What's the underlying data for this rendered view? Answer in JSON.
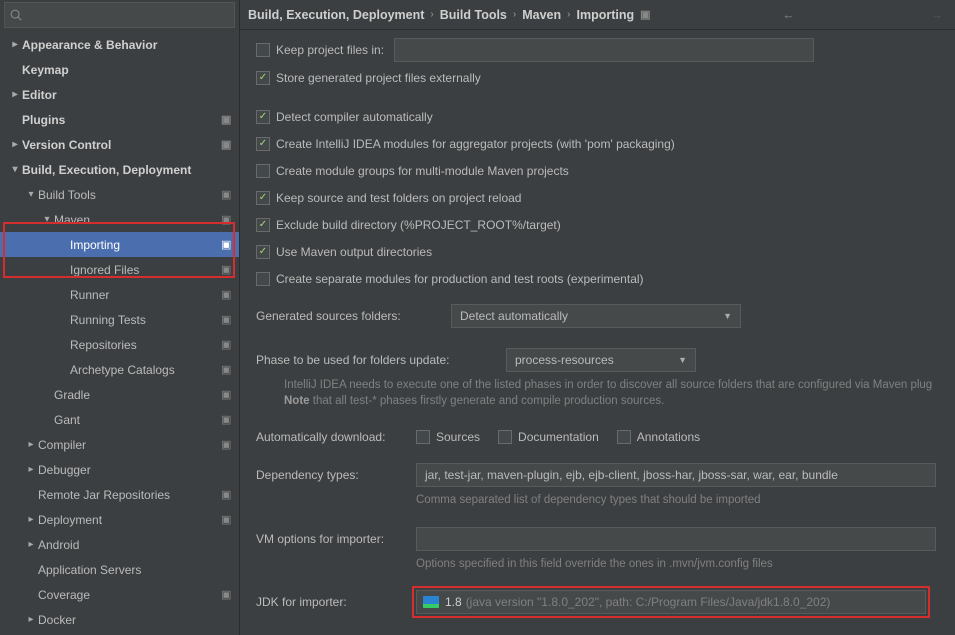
{
  "breadcrumb": [
    "Build, Execution, Deployment",
    "Build Tools",
    "Maven",
    "Importing"
  ],
  "sidebar": {
    "items": [
      {
        "label": "Appearance & Behavior",
        "indent": 0,
        "kind": "group",
        "arrow": "right",
        "bold": true,
        "gear": false
      },
      {
        "label": "Keymap",
        "indent": 0,
        "kind": "item",
        "arrow": "none",
        "bold": true,
        "gear": false
      },
      {
        "label": "Editor",
        "indent": 0,
        "kind": "group",
        "arrow": "right",
        "bold": true,
        "gear": false
      },
      {
        "label": "Plugins",
        "indent": 0,
        "kind": "item",
        "arrow": "none",
        "bold": true,
        "gear": true
      },
      {
        "label": "Version Control",
        "indent": 0,
        "kind": "group",
        "arrow": "right",
        "bold": true,
        "gear": true
      },
      {
        "label": "Build, Execution, Deployment",
        "indent": 0,
        "kind": "group",
        "arrow": "down",
        "bold": true,
        "gear": false
      },
      {
        "label": "Build Tools",
        "indent": 1,
        "kind": "group",
        "arrow": "down",
        "bold": false,
        "gear": true
      },
      {
        "label": "Maven",
        "indent": 2,
        "kind": "group",
        "arrow": "down",
        "bold": false,
        "gear": true
      },
      {
        "label": "Importing",
        "indent": 3,
        "kind": "item",
        "arrow": "none",
        "bold": false,
        "gear": true,
        "selected": true
      },
      {
        "label": "Ignored Files",
        "indent": 3,
        "kind": "item",
        "arrow": "none",
        "bold": false,
        "gear": true
      },
      {
        "label": "Runner",
        "indent": 3,
        "kind": "item",
        "arrow": "none",
        "bold": false,
        "gear": true
      },
      {
        "label": "Running Tests",
        "indent": 3,
        "kind": "item",
        "arrow": "none",
        "bold": false,
        "gear": true
      },
      {
        "label": "Repositories",
        "indent": 3,
        "kind": "item",
        "arrow": "none",
        "bold": false,
        "gear": true
      },
      {
        "label": "Archetype Catalogs",
        "indent": 3,
        "kind": "item",
        "arrow": "none",
        "bold": false,
        "gear": true
      },
      {
        "label": "Gradle",
        "indent": 2,
        "kind": "item",
        "arrow": "none",
        "bold": false,
        "gear": true
      },
      {
        "label": "Gant",
        "indent": 2,
        "kind": "item",
        "arrow": "none",
        "bold": false,
        "gear": true
      },
      {
        "label": "Compiler",
        "indent": 1,
        "kind": "group",
        "arrow": "right",
        "bold": false,
        "gear": true
      },
      {
        "label": "Debugger",
        "indent": 1,
        "kind": "group",
        "arrow": "right",
        "bold": false,
        "gear": false
      },
      {
        "label": "Remote Jar Repositories",
        "indent": 1,
        "kind": "item",
        "arrow": "none",
        "bold": false,
        "gear": true
      },
      {
        "label": "Deployment",
        "indent": 1,
        "kind": "group",
        "arrow": "right",
        "bold": false,
        "gear": true
      },
      {
        "label": "Android",
        "indent": 1,
        "kind": "group",
        "arrow": "right",
        "bold": false,
        "gear": false
      },
      {
        "label": "Application Servers",
        "indent": 1,
        "kind": "item",
        "arrow": "none",
        "bold": false,
        "gear": false
      },
      {
        "label": "Coverage",
        "indent": 1,
        "kind": "item",
        "arrow": "none",
        "bold": false,
        "gear": true
      },
      {
        "label": "Docker",
        "indent": 1,
        "kind": "group",
        "arrow": "right",
        "bold": false,
        "gear": false
      }
    ]
  },
  "opts": {
    "keepProjectFiles": {
      "label": "Keep project files in:",
      "checked": false
    },
    "storeExternally": {
      "label": "Store generated project files externally",
      "checked": true
    },
    "detectCompiler": {
      "label": "Detect compiler automatically",
      "checked": true
    },
    "createModules": {
      "label": "Create IntelliJ IDEA modules for aggregator projects (with 'pom' packaging)",
      "checked": true
    },
    "createGroups": {
      "label": "Create module groups for multi-module Maven projects",
      "checked": false
    },
    "keepFolders": {
      "label": "Keep source and test folders on project reload",
      "checked": true
    },
    "excludeBuild": {
      "label": "Exclude build directory (%PROJECT_ROOT%/target)",
      "checked": true
    },
    "useMavenDirs": {
      "label": "Use Maven output directories",
      "checked": true
    },
    "separateModules": {
      "label": "Create separate modules for production and test roots (experimental)",
      "checked": false
    }
  },
  "genSources": {
    "label": "Generated sources folders:",
    "value": "Detect automatically"
  },
  "phase": {
    "label": "Phase to be used for folders update:",
    "value": "process-resources",
    "hint_a": "IntelliJ IDEA needs to execute one of the listed phases in order to discover all source folders that are configured via Maven plug",
    "hint_b": "Note",
    "hint_c": " that all test-* phases firstly generate and compile production sources."
  },
  "autoDl": {
    "label": "Automatically download:",
    "sources": "Sources",
    "docs": "Documentation",
    "annot": "Annotations"
  },
  "depTypes": {
    "label": "Dependency types:",
    "value": "jar, test-jar, maven-plugin, ejb, ejb-client, jboss-har, jboss-sar, war, ear, bundle",
    "hint": "Comma separated list of dependency types that should be imported"
  },
  "vm": {
    "label": "VM options for importer:",
    "hint": "Options specified in this field override the ones in .mvn/jvm.config files"
  },
  "jdk": {
    "label": "JDK for importer:",
    "version": "1.8",
    "path": "(java version \"1.8.0_202\", path: C:/Program Files/Java/jdk1.8.0_202)"
  }
}
